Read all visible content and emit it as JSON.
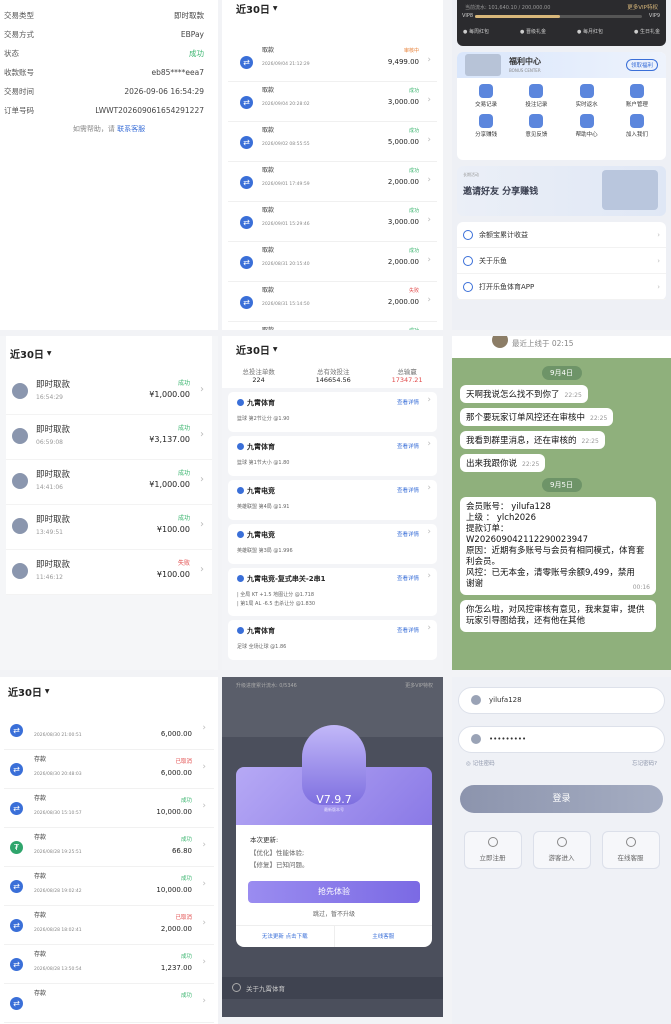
{
  "p1": {
    "rows": [
      {
        "k": "交易类型",
        "v": "即时取款"
      },
      {
        "k": "交易方式",
        "v": "EBPay"
      },
      {
        "k": "状态",
        "v": "成功"
      },
      {
        "k": "收款账号",
        "v": "eb85****eea7"
      },
      {
        "k": "交易时间",
        "v": "2026-09-06 16:54:29"
      },
      {
        "k": "订单号码",
        "v": "LWWT202609061654291227"
      }
    ],
    "help_prefix": "如需帮助，请",
    "help_link": "联系客服"
  },
  "p2": {
    "filter": "近30日",
    "rows": [
      {
        "t": "取款",
        "d": "2026/09/04 21:12:29",
        "s": "审核中",
        "amt": "9,499.00"
      },
      {
        "t": "取款",
        "d": "2026/09/04 20:28:02",
        "s": "成功",
        "amt": "3,000.00"
      },
      {
        "t": "取款",
        "d": "2026/09/02 08:55:55",
        "s": "成功",
        "amt": "5,000.00"
      },
      {
        "t": "取款",
        "d": "2026/09/01 17:49:59",
        "s": "成功",
        "amt": "2,000.00"
      },
      {
        "t": "取款",
        "d": "2026/09/01 15:29:46",
        "s": "成功",
        "amt": "3,000.00"
      },
      {
        "t": "取款",
        "d": "2026/08/31 20:15:40",
        "s": "成功",
        "amt": "2,000.00"
      },
      {
        "t": "取款",
        "d": "2026/08/31 15:14:50",
        "s": "失败",
        "amt": "2,000.00"
      },
      {
        "t": "取款",
        "d": "",
        "s": "成功",
        "amt": ""
      }
    ]
  },
  "p3": {
    "vip_progress_text": "当前流水: 101,640.10 / 200,000.00",
    "vip_more": "更多VIP特权",
    "vip_left": "VIP8",
    "vip_right": "VIP9",
    "vip_progress": 0.51,
    "vip_buttons": [
      "每周红包",
      "晋级礼金",
      "每月红包",
      "生日礼金"
    ],
    "welfare_title": "福利中心",
    "welfare_sub": "BONUS CENTER",
    "welfare_btn": "领取福利",
    "grid": [
      "交易记录",
      "投注记录",
      "实时返水",
      "账户管理",
      "分享赚钱",
      "意见反馈",
      "帮助中心",
      "加入我们"
    ],
    "banner_small": "长期活动",
    "banner_title": "邀请好友 分享赚钱",
    "menu": [
      "余额宝累计收益",
      "关于乐鱼",
      "打开乐鱼体育APP"
    ]
  },
  "p4": {
    "filter": "近30日",
    "rows": [
      {
        "t": "即时取款",
        "d": "16:54:29",
        "s": "成功",
        "amt": "¥1,000.00"
      },
      {
        "t": "即时取款",
        "d": "06:59:08",
        "s": "成功",
        "amt": "¥3,137.00"
      },
      {
        "t": "即时取款",
        "d": "14:41:06",
        "s": "成功",
        "amt": "¥1,000.00"
      },
      {
        "t": "即时取款",
        "d": "13:49:51",
        "s": "成功",
        "amt": "¥100.00"
      },
      {
        "t": "即时取款",
        "d": "11:46:12",
        "s": "失败",
        "amt": "¥100.00"
      }
    ]
  },
  "p5": {
    "filter": "近30日",
    "stats": [
      {
        "k": "总投注单数",
        "v": "224"
      },
      {
        "k": "总有效投注",
        "v": "146654.56"
      },
      {
        "k": "总输赢",
        "v": "17347.21"
      }
    ],
    "detail": "查看详情",
    "cards": [
      {
        "t": "九霄体育",
        "s": "篮球 第2节让分 @1.90"
      },
      {
        "t": "九霄体育",
        "s": "篮球 第1节大小 @1.80"
      },
      {
        "t": "九霄电竞",
        "s": "英雄联盟 第4局 @1.91"
      },
      {
        "t": "九霄电竞",
        "s": "英雄联盟 第3局 @1.996"
      },
      {
        "t": "九霄电竞-复式串关-2串1",
        "s": "| 全局 KT +1.5 地图让分 @1.718",
        "s2": "| 第1局 AL -6.5 击杀让分 @1.830"
      },
      {
        "t": "九霄体育",
        "s": "足球 全场让球 @1.86"
      }
    ]
  },
  "p6": {
    "status": "最近上线于 02:15",
    "date1": "9月4日",
    "msgs": [
      {
        "m": "天啊我说怎么找不到你了",
        "t": "22:25"
      },
      {
        "m": "那个要玩家订单风控还在审核中",
        "t": "22:25"
      },
      {
        "m": "我看到群里消息，还在审核的",
        "t": "22:25"
      },
      {
        "m": "出来我跟你说",
        "t": "22:25"
      }
    ],
    "date2": "9月5日",
    "big_lines": [
      "会员账号：  yilufa128",
      "上级      ：  ylch2026",
      "提款订单：",
      "W202609042112290023947",
      "原因：近期有多账号与会员有相同模式，体育套利会员。",
      "风控：已无本金，清零账号余额9,499，禁用",
      "谢谢"
    ],
    "big_time": "00:16",
    "last": "你怎么啦，对风控审核有意见，我来复审，提供玩家引导图给我，还有他在其他"
  },
  "p7": {
    "filter": "近30日",
    "rows": [
      {
        "t": "",
        "d": "2026/08/30 21:00:51",
        "s": "",
        "amt": "6,000.00",
        "g": false
      },
      {
        "t": "存款",
        "d": "2026/08/30 20:48:03",
        "s": "已取消",
        "amt": "6,000.00",
        "g": false
      },
      {
        "t": "存款",
        "d": "2026/08/30 15:10:57",
        "s": "成功",
        "amt": "10,000.00",
        "g": false
      },
      {
        "t": "存款",
        "d": "2026/08/28 19:25:51",
        "s": "成功",
        "amt": "66.80",
        "g": true
      },
      {
        "t": "存款",
        "d": "2026/08/28 19:02:42",
        "s": "成功",
        "amt": "10,000.00",
        "g": false
      },
      {
        "t": "存款",
        "d": "2026/08/28 18:02:41",
        "s": "已取消",
        "amt": "2,000.00",
        "g": false
      },
      {
        "t": "存款",
        "d": "2026/08/28 13:50:54",
        "s": "成功",
        "amt": "1,237.00",
        "g": false
      },
      {
        "t": "存款",
        "d": "",
        "s": "成功",
        "amt": "",
        "g": false
      }
    ]
  },
  "p8": {
    "top_left": "升级进度累计流水: 0/5346",
    "top_right": "更多VIP特权",
    "version": "V7.9.7",
    "version_sub": "最新版本号",
    "update_title": "本次更新:",
    "u1": "【优化】性能体验;",
    "u2": "【修复】已知问题。",
    "btn": "抢先体验",
    "skip": "跳过，暂不升级",
    "foot_left": "无法更新 点击下载",
    "foot_right": "主线客服",
    "about": "关于九霄体育"
  },
  "p9": {
    "user": "yilufa128",
    "pwd": "•••••••••",
    "remember": "记住密码",
    "forgot": "忘记密码?",
    "login": "登录",
    "actions": [
      "立即注册",
      "游客进入",
      "在线客服"
    ]
  },
  "colors": {
    "accent": "#3a6fd8",
    "success": "#3bb56f",
    "fail": "#e14b4b",
    "warn": "#e8833a"
  }
}
